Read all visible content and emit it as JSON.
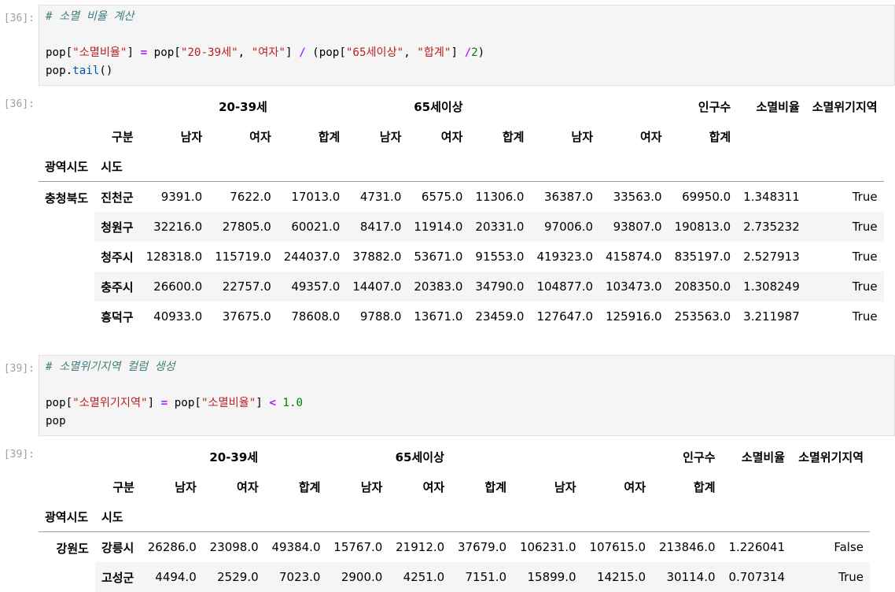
{
  "cells": [
    {
      "in_prompt": "[36]:",
      "code": {
        "comment": "# 소멸 비율 계산",
        "line2": {
          "p1": "pop[",
          "s1": "\"소멸비율\"",
          "p2": "] ",
          "op1": "=",
          "p3": " pop[",
          "s2": "\"20-39세\"",
          "p4": ", ",
          "s3": "\"여자\"",
          "p5": "] ",
          "op2": "/",
          "p6": " (pop[",
          "s4": "\"65세이상\"",
          "p7": ", ",
          "s5": "\"합계\"",
          "p8": "] ",
          "op3": "/",
          "n1": "2",
          "p9": ")"
        },
        "line3": {
          "p1": "pop.",
          "attr": "tail",
          "p2": "()"
        }
      },
      "out_prompt": "[36]:"
    },
    {
      "in_prompt": "[39]:",
      "code": {
        "comment": "# 소멸위기지역 컬럼 생성",
        "line2": {
          "p1": "pop[",
          "s1": "\"소멸위기지역\"",
          "p2": "] ",
          "op1": "=",
          "p3": " pop[",
          "s2": "\"소멸비율\"",
          "p4": "] ",
          "op2": "<",
          "p5": " ",
          "n1": "1.0"
        },
        "line3": {
          "p1": "pop"
        }
      },
      "out_prompt": "[39]:"
    }
  ],
  "table": {
    "group_headers": [
      "20-39세",
      "65세이상",
      "인구수",
      "소멸비율",
      "소멸위기지역"
    ],
    "sub_header_label": "구분",
    "sub_headers": [
      "남자",
      "여자",
      "합계",
      "남자",
      "여자",
      "합계",
      "남자",
      "여자",
      "합계"
    ],
    "index_names": [
      "광역시도",
      "시도"
    ]
  },
  "table1": {
    "l0": "충청북도",
    "rows": [
      {
        "l1": "진천군",
        "v": [
          "9391.0",
          "7622.0",
          "17013.0",
          "4731.0",
          "6575.0",
          "11306.0",
          "36387.0",
          "33563.0",
          "69950.0",
          "1.348311",
          "True"
        ]
      },
      {
        "l1": "청원구",
        "v": [
          "32216.0",
          "27805.0",
          "60021.0",
          "8417.0",
          "11914.0",
          "20331.0",
          "97006.0",
          "93807.0",
          "190813.0",
          "2.735232",
          "True"
        ]
      },
      {
        "l1": "청주시",
        "v": [
          "128318.0",
          "115719.0",
          "244037.0",
          "37882.0",
          "53671.0",
          "91553.0",
          "419323.0",
          "415874.0",
          "835197.0",
          "2.527913",
          "True"
        ]
      },
      {
        "l1": "충주시",
        "v": [
          "26600.0",
          "22757.0",
          "49357.0",
          "14407.0",
          "20383.0",
          "34790.0",
          "104877.0",
          "103473.0",
          "208350.0",
          "1.308249",
          "True"
        ]
      },
      {
        "l1": "흥덕구",
        "v": [
          "40933.0",
          "37675.0",
          "78608.0",
          "9788.0",
          "13671.0",
          "23459.0",
          "127647.0",
          "125916.0",
          "253563.0",
          "3.211987",
          "True"
        ]
      }
    ]
  },
  "table2": {
    "l0": "강원도",
    "rows": [
      {
        "l1": "강릉시",
        "v": [
          "26286.0",
          "23098.0",
          "49384.0",
          "15767.0",
          "21912.0",
          "37679.0",
          "106231.0",
          "107615.0",
          "213846.0",
          "1.226041",
          "False"
        ]
      },
      {
        "l1": "고성군",
        "v": [
          "4494.0",
          "2529.0",
          "7023.0",
          "2900.0",
          "4251.0",
          "7151.0",
          "15899.0",
          "14215.0",
          "30114.0",
          "0.707314",
          "True"
        ]
      }
    ]
  }
}
